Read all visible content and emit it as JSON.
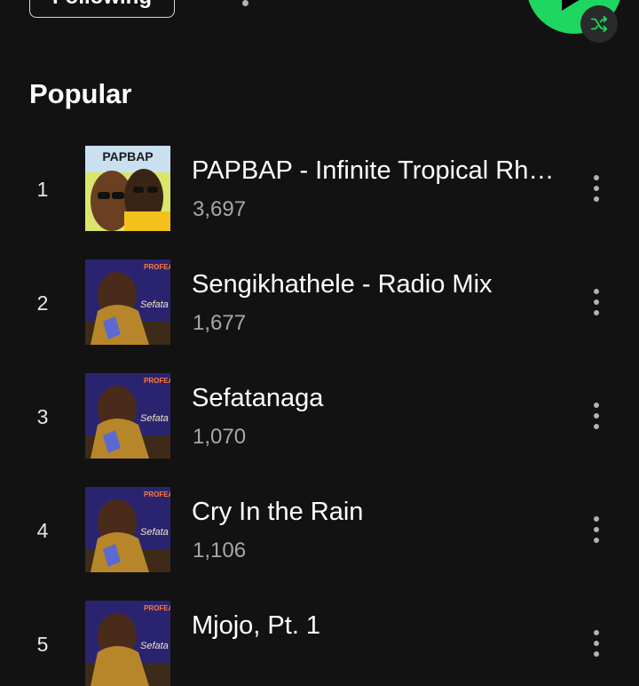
{
  "header": {
    "follow_label": "Following",
    "more_icon": "more-options-icon",
    "play_icon": "play-icon",
    "shuffle_icon": "shuffle-icon",
    "accent_color": "#1ed760"
  },
  "popular": {
    "title": "Popular",
    "tracks": [
      {
        "rank": "1",
        "title": "PAPBAP - Infinite Tropical Rhythm",
        "plays": "3,697",
        "cover_text": "PAPBAP"
      },
      {
        "rank": "2",
        "title": "Sengikhathele - Radio Mix",
        "plays": "1,677",
        "cover_text": "PROFEAYO"
      },
      {
        "rank": "3",
        "title": "Sefatanaga",
        "plays": "1,070",
        "cover_text": "PROFEAYO"
      },
      {
        "rank": "4",
        "title": "Cry In the Rain",
        "plays": "1,106",
        "cover_text": "PROFEAYO"
      },
      {
        "rank": "5",
        "title": "Mjojo, Pt. 1",
        "plays": "",
        "cover_text": "PROFEAYO"
      }
    ]
  }
}
